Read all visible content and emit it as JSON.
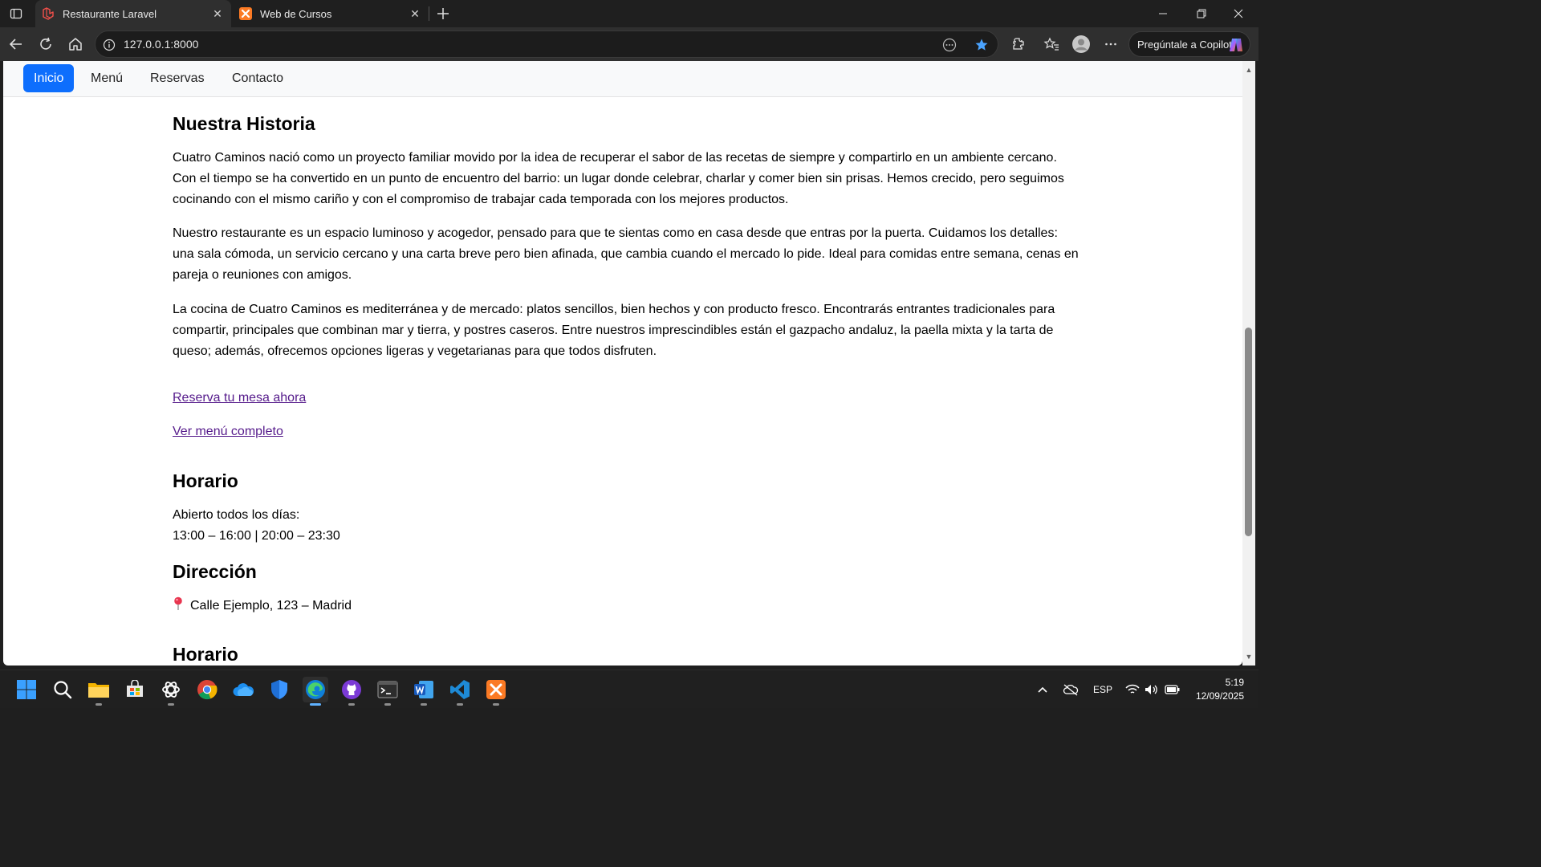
{
  "browser": {
    "tabs": [
      {
        "title": "Restaurante Laravel",
        "active": true,
        "icon": "laravel-icon"
      },
      {
        "title": "Web de Cursos",
        "active": false,
        "icon": "xampp-icon"
      }
    ],
    "url": "127.0.0.1:8000",
    "copilot_label": "Pregúntale a Copilot"
  },
  "site": {
    "nav": [
      {
        "label": "Inicio",
        "active": true
      },
      {
        "label": "Menú",
        "active": false
      },
      {
        "label": "Reservas",
        "active": false
      },
      {
        "label": "Contacto",
        "active": false
      }
    ],
    "historia": {
      "heading": "Nuestra Historia",
      "paragraphs": [
        "Cuatro Caminos nació como un proyecto familiar movido por la idea de recuperar el sabor de las recetas de siempre y compartirlo en un ambiente cercano. Con el tiempo se ha convertido en un punto de encuentro del barrio: un lugar donde celebrar, charlar y comer bien sin prisas. Hemos crecido, pero seguimos cocinando con el mismo cariño y con el compromiso de trabajar cada temporada con los mejores productos.",
        "Nuestro restaurante es un espacio luminoso y acogedor, pensado para que te sientas como en casa desde que entras por la puerta. Cuidamos los detalles: una sala cómoda, un servicio cercano y una carta breve pero bien afinada, que cambia cuando el mercado lo pide. Ideal para comidas entre semana, cenas en pareja o reuniones con amigos.",
        "La cocina de Cuatro Caminos es mediterránea y de mercado: platos sencillos, bien hechos y con producto fresco. Encontrarás entrantes tradicionales para compartir, principales que combinan mar y tierra, y postres caseros. Entre nuestros imprescindibles están el gazpacho andaluz, la paella mixta y la tarta de queso; además, ofrecemos opciones ligeras y vegetarianas para que todos disfruten."
      ]
    },
    "links": {
      "reserva": "Reserva tu mesa ahora",
      "menu": "Ver menú completo"
    },
    "horario": {
      "heading": "Horario",
      "line1": "Abierto todos los días:",
      "line2": "13:00 – 16:00 | 20:00 – 23:30"
    },
    "direccion": {
      "heading": "Dirección",
      "address": "Calle Ejemplo, 123 – Madrid"
    },
    "horario2_heading": "Horario"
  },
  "taskbar": {
    "apps": [
      "windows-start-icon",
      "search-icon",
      "file-explorer-icon",
      "store-icon",
      "chatgpt-icon",
      "chrome-icon",
      "onedrive-icon",
      "defender-icon",
      "edge-icon",
      "github-icon",
      "terminal-icon",
      "word-icon",
      "vscode-icon",
      "xampp-icon"
    ],
    "language": "ESP",
    "time": "5:19",
    "date": "12/09/2025"
  },
  "colors": {
    "accent": "#0d6efd",
    "link_visited": "#551a8b",
    "chrome_bg": "#1f1f1f"
  }
}
